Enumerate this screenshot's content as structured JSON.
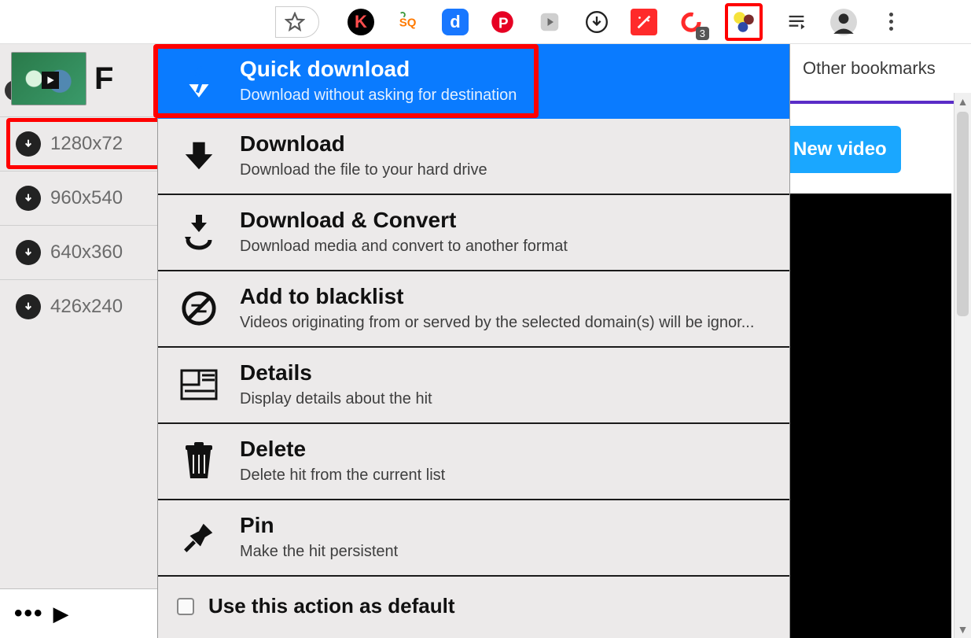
{
  "toolbar": {
    "icons": [
      {
        "name": "star-icon"
      },
      {
        "name": "k-extension-icon",
        "label": "K",
        "bg": "#000",
        "fg": "#ff4d4d"
      },
      {
        "name": "sq-extension-icon",
        "label": "SQ",
        "bg": "#fff",
        "fg": "#ff7a00"
      },
      {
        "name": "d-extension-icon",
        "label": "d",
        "bg": "#1877ff",
        "fg": "#fff"
      },
      {
        "name": "pinterest-icon",
        "label": "P",
        "bg": "#fff",
        "fg": "#e60023"
      },
      {
        "name": "play-store-icon"
      },
      {
        "name": "circle-download-icon",
        "bg": "#fff",
        "fg": "#222"
      },
      {
        "name": "wand-extension-icon",
        "bg": "#ff2a2a",
        "fg": "#fff"
      },
      {
        "name": "c-badge-icon",
        "label": "C",
        "fg": "#ff2a2a",
        "badge": "3"
      },
      {
        "name": "vdh-balls-icon",
        "highlight": true
      },
      {
        "name": "queue-icon"
      },
      {
        "name": "avatar-icon"
      },
      {
        "name": "overflow-menu-icon"
      }
    ]
  },
  "bookmarks": {
    "other": "Other bookmarks"
  },
  "sidebar": {
    "title_letter": "F",
    "resolutions": [
      {
        "label": "1280x72",
        "highlight": true
      },
      {
        "label": "960x540"
      },
      {
        "label": "640x360"
      },
      {
        "label": "426x240"
      }
    ]
  },
  "menu": {
    "items": [
      {
        "key": "quick",
        "title": "Quick download",
        "desc": "Download without asking for destination",
        "selected": true,
        "highlight": true
      },
      {
        "key": "download",
        "title": "Download",
        "desc": "Download the file to your hard drive"
      },
      {
        "key": "convert",
        "title": "Download & Convert",
        "desc": "Download media and convert to another format"
      },
      {
        "key": "blacklist",
        "title": "Add to blacklist",
        "desc": "Videos originating from or served by the selected domain(s) will be ignor..."
      },
      {
        "key": "details",
        "title": "Details",
        "desc": "Display details about the hit"
      },
      {
        "key": "delete",
        "title": "Delete",
        "desc": "Delete hit from the current list"
      },
      {
        "key": "pin",
        "title": "Pin",
        "desc": "Make the hit persistent"
      }
    ],
    "default_label": "Use this action as default"
  },
  "right": {
    "new_video": "New video"
  }
}
